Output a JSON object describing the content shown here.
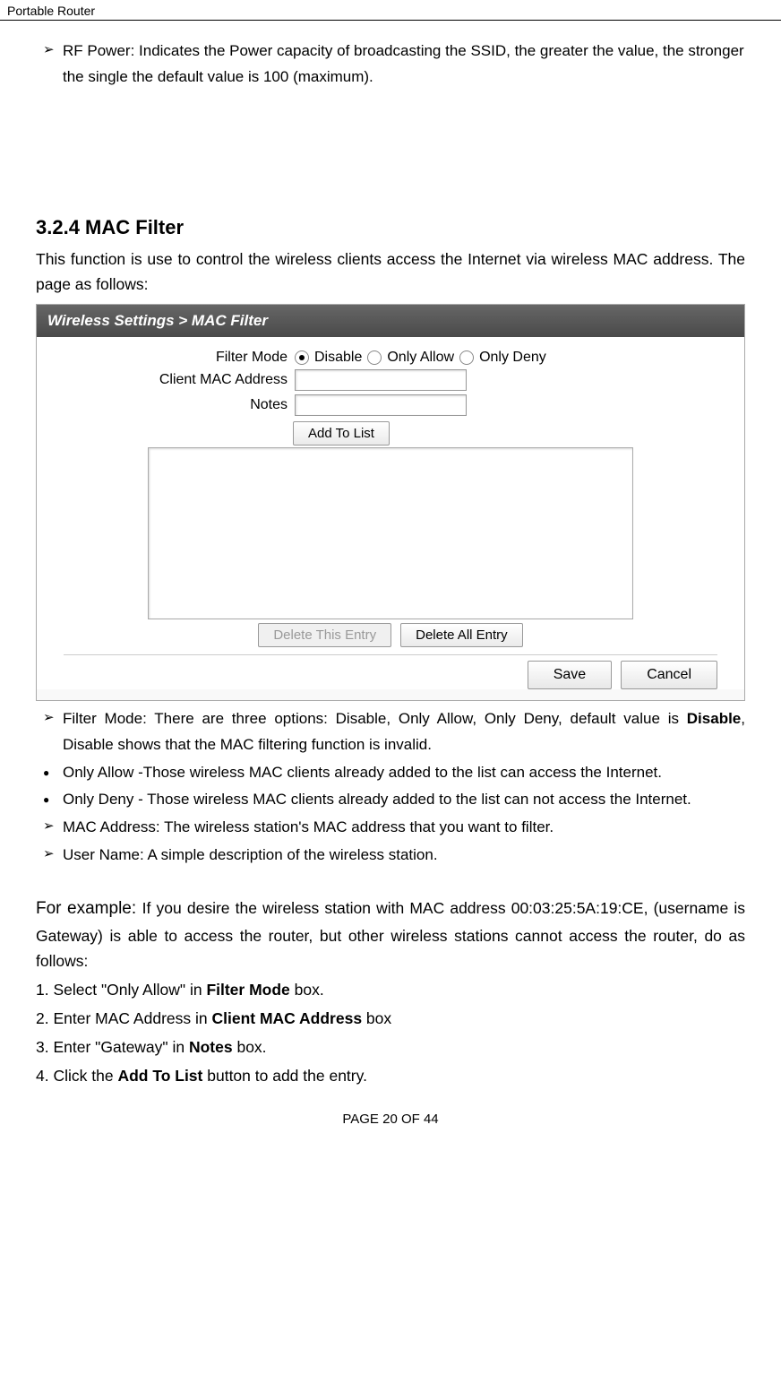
{
  "header": {
    "title": "Portable Router"
  },
  "intro": {
    "rfpower": "RF Power: Indicates the Power capacity of broadcasting the SSID, the greater the value, the stronger the single the default value is 100 (maximum)."
  },
  "section": {
    "heading": "3.2.4 MAC Filter",
    "lead": "This function is use to control the wireless clients access the Internet via wireless MAC address. The page as follows:"
  },
  "screenshot": {
    "title": "Wireless Settings > MAC Filter",
    "rows": {
      "filtermode_label": "Filter Mode",
      "radio_disable": "Disable",
      "radio_allow": "Only Allow",
      "radio_deny": "Only Deny",
      "clientmac_label": "Client MAC Address",
      "notes_label": "Notes"
    },
    "buttons": {
      "add": "Add To List",
      "delete_this": "Delete This Entry",
      "delete_all": "Delete All Entry",
      "save": "Save",
      "cancel": "Cancel"
    }
  },
  "bullets": {
    "filtermode_a": "Filter Mode: There are three options: Disable, Only Allow, Only Deny, default value is ",
    "filtermode_b": "Disable",
    "filtermode_c": ", Disable shows that the MAC filtering function is invalid.",
    "only_allow": "Only Allow -Those wireless MAC clients already added to the list can access the Internet.",
    "only_deny": "Only Deny - Those wireless MAC clients already added to the list can not access the Internet.",
    "macaddr": "MAC Address: The wireless station's MAC address that you want to filter.",
    "username": "User Name: A simple description of the wireless station."
  },
  "example": {
    "lead_a": "For example: ",
    "lead_b": "If you desire the wireless station with MAC address 00:03:25:5A:19:CE, (username is Gateway) is able to access the router, but other wireless stations cannot access the router, do as follows:",
    "s1a": "1. Select \"Only Allow\" in ",
    "s1b": "Filter Mode",
    "s1c": " box.",
    "s2a": "2. Enter MAC Address in ",
    "s2b": "Client MAC Address",
    "s2c": " box",
    "s3a": "3. Enter \"Gateway\" in ",
    "s3b": "Notes",
    "s3c": " box.",
    "s4a": "4. Click the ",
    "s4b": "Add To List",
    "s4c": " button to add the entry."
  },
  "footer": {
    "text": "PAGE    20    OF    44"
  }
}
